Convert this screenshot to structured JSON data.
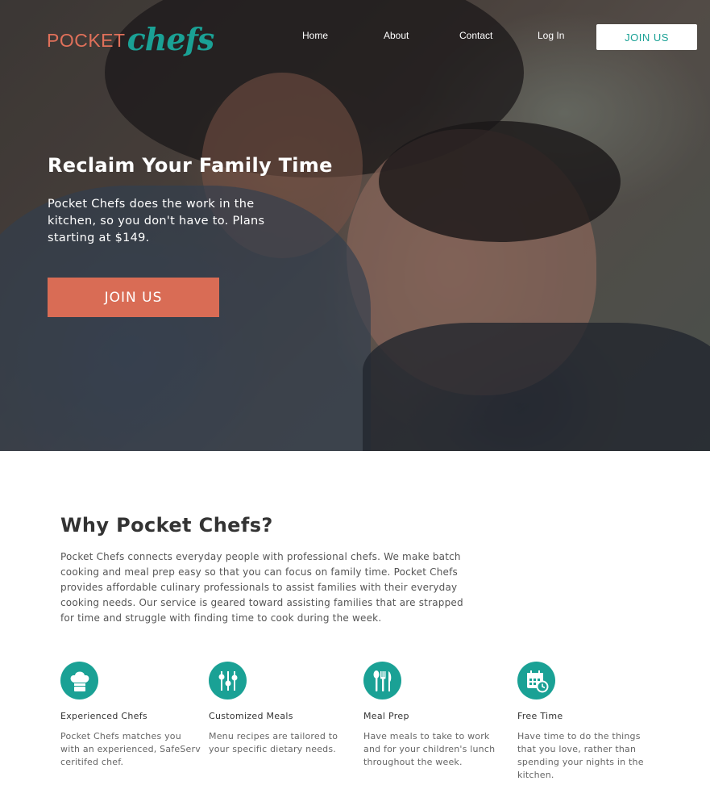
{
  "brand": {
    "logo_part1": "POCKET",
    "logo_part2": "chefs",
    "primary_color": "#1aa195",
    "accent_color": "#d96c55"
  },
  "nav": {
    "items": [
      {
        "label": "Home"
      },
      {
        "label": "About"
      },
      {
        "label": "Contact"
      },
      {
        "label": "Log In"
      }
    ],
    "join_label": "JOIN US"
  },
  "hero": {
    "title": "Reclaim Your Family Time",
    "text": "Pocket Chefs does the work in the kitchen, so you don't have to. Plans starting at $149.",
    "cta_label": "JOIN US"
  },
  "why": {
    "title": "Why Pocket Chefs?",
    "text": "Pocket Chefs connects everyday people with professional chefs. We make batch cooking and meal prep easy so that you can focus on family time. Pocket Chefs provides affordable culinary professionals to assist families with their everyday cooking needs. Our service is geared toward assisting families that are strapped for time and struggle with finding time to cook during the week."
  },
  "features": [
    {
      "icon": "chef-hat-icon",
      "title": "Experienced Chefs",
      "desc": "Pocket Chefs matches you with an experienced, SafeServ ceritifed chef."
    },
    {
      "icon": "sliders-icon",
      "title": "Customized Meals",
      "desc": "Menu recipes are tailored to your specific dietary needs."
    },
    {
      "icon": "utensils-icon",
      "title": "Meal Prep",
      "desc": "Have meals to take to work and for your children's lunch throughout the week."
    },
    {
      "icon": "calendar-clock-icon",
      "title": "Free Time",
      "desc": "Have time to do the things that you love, rather than spending your nights in the kitchen."
    }
  ]
}
